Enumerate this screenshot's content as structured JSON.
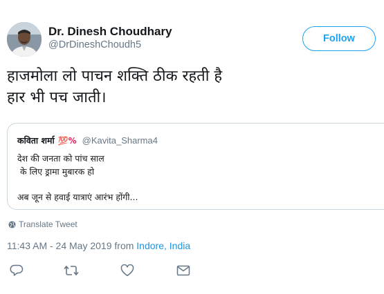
{
  "author": {
    "display_name": "Dr. Dinesh Choudhary",
    "handle": "@DrDineshChoudh5",
    "avatar_icon": "profile-avatar"
  },
  "follow_button": {
    "label": "Follow"
  },
  "tweet": {
    "lines": [
      "हाजमोला लो पाचन शक्ति ठीक रहती है",
      "हार भी पच जाती।"
    ]
  },
  "quoted_tweet": {
    "display_name": "कविता शर्मा",
    "emoji": "💯%",
    "handle": "@Kavita_Sharma4",
    "lines": [
      "देश की जनता को पांच साल",
      " के लिए ड्रामा मुबारक हो",
      "अब जून से हवाई यात्राएं आरंभ होंगी..."
    ]
  },
  "translate": {
    "label": "Translate Tweet",
    "icon": "globe-icon"
  },
  "meta": {
    "time": "11:43 AM - 24 May 2019 from ",
    "place_city": "Indore",
    "place_sep": ", ",
    "place_country": "India"
  },
  "actions": {
    "reply_icon": "reply-icon",
    "retweet_icon": "retweet-icon",
    "like_icon": "heart-icon",
    "dm_icon": "envelope-icon"
  },
  "colors": {
    "accent": "#1da1f2",
    "link": "#1b95e0",
    "secondary_text": "#657786",
    "border": "#ccd6dd"
  }
}
